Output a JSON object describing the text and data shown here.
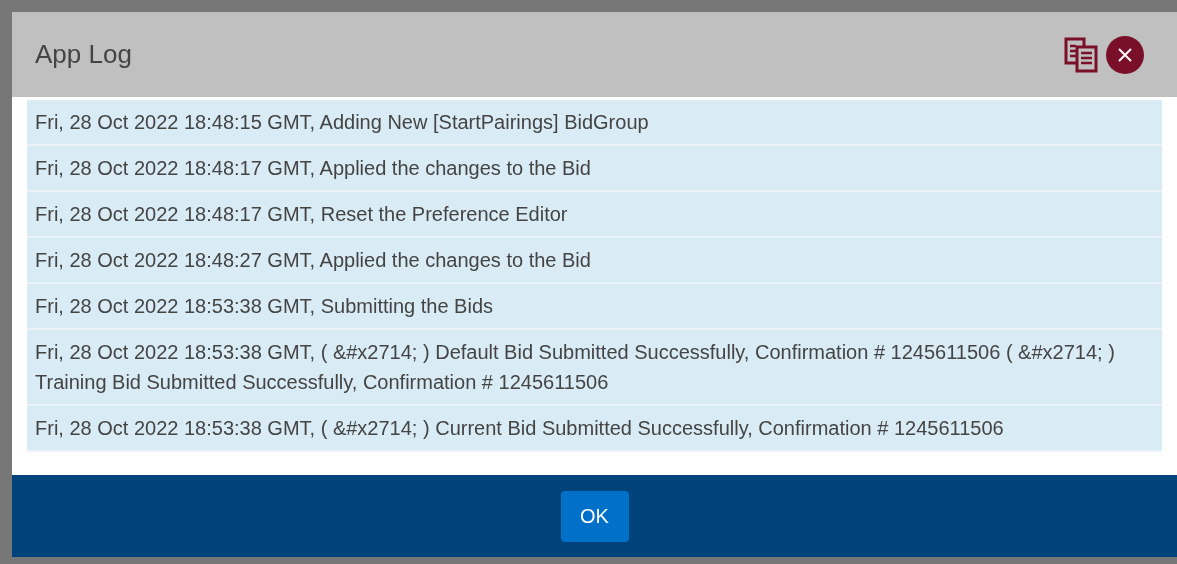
{
  "dialog": {
    "title": "App Log"
  },
  "log_entries": [
    "Fri, 28 Oct 2022 18:48:15 GMT, Adding New [StartPairings] BidGroup",
    "Fri, 28 Oct 2022 18:48:17 GMT, Applied the changes to the Bid",
    "Fri, 28 Oct 2022 18:48:17 GMT, Reset the Preference Editor",
    "Fri, 28 Oct 2022 18:48:27 GMT, Applied the changes to the Bid",
    "Fri, 28 Oct 2022 18:53:38 GMT, Submitting the Bids",
    "Fri, 28 Oct 2022 18:53:38 GMT, ( &#x2714; ) Default Bid Submitted Successfully, Confirmation # 1245611506 ( &#x2714; ) Training Bid Submitted Successfully, Confirmation # 1245611506",
    "Fri, 28 Oct 2022 18:53:38 GMT, ( &#x2714; ) Current Bid Submitted Successfully, Confirmation # 1245611506"
  ],
  "footer": {
    "ok_button": "OK"
  }
}
